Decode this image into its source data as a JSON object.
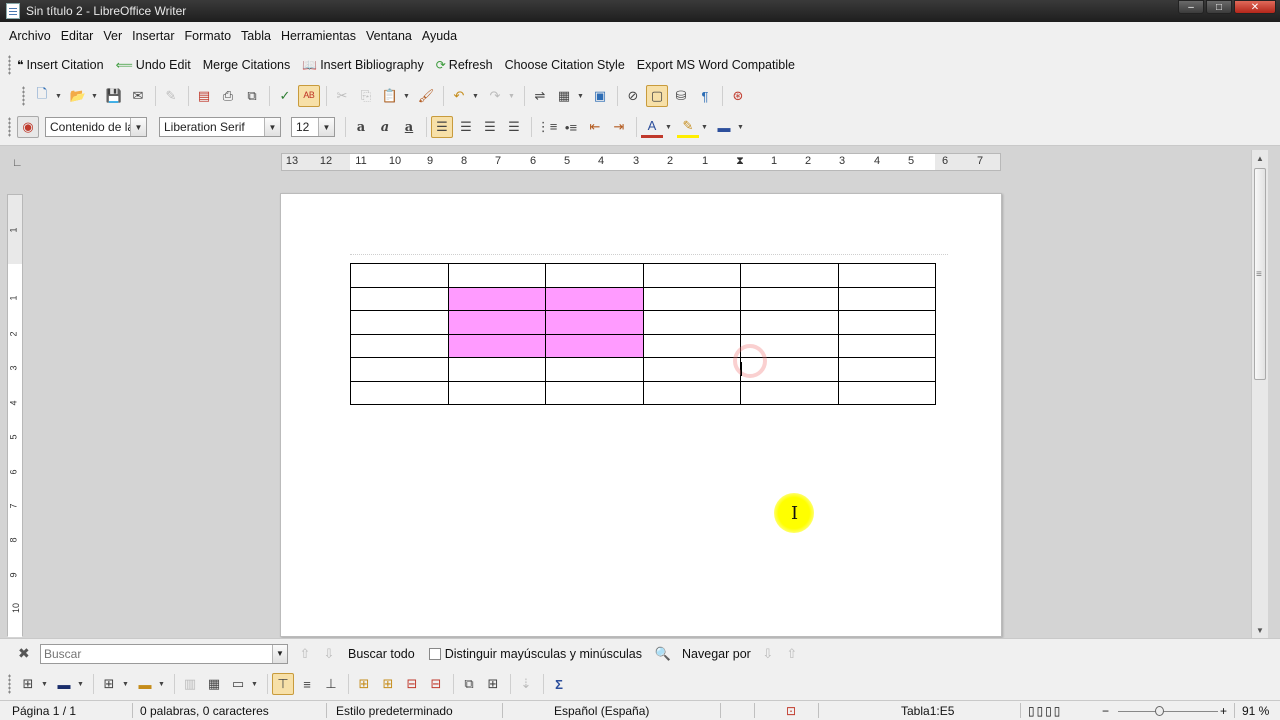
{
  "window": {
    "title": "Sin título 2 - LibreOffice Writer",
    "min": "–",
    "max": "□",
    "close": "✕"
  },
  "menu": [
    "Archivo",
    "Editar",
    "Ver",
    "Insertar",
    "Formato",
    "Tabla",
    "Herramientas",
    "Ventana",
    "Ayuda"
  ],
  "zotero": {
    "insert_citation": "Insert Citation",
    "undo_edit": "Undo Edit",
    "merge_citations": "Merge Citations",
    "insert_bibliography": "Insert Bibliography",
    "refresh": "Refresh",
    "choose_style": "Choose Citation Style",
    "export": "Export MS Word Compatible"
  },
  "formatting": {
    "paragraph_style": "Contenido de la",
    "font_name": "Liberation Serif",
    "font_size": "12"
  },
  "ruler": {
    "labels": [
      "13",
      "12",
      "11",
      "10",
      "9",
      "8",
      "7",
      "6",
      "5",
      "4",
      "3",
      "2",
      "1",
      "1",
      "2",
      "3",
      "4",
      "5",
      "6",
      "7"
    ],
    "vlabels": [
      "1",
      "1",
      "2",
      "3",
      "4",
      "5",
      "6",
      "7",
      "8",
      "9",
      "10"
    ]
  },
  "document": {
    "table": {
      "rows": 6,
      "cols": 6,
      "highlight_color": "#ff9bff"
    }
  },
  "find": {
    "placeholder": "Buscar",
    "find_all": "Buscar todo",
    "match_case": "Distinguir mayúsculas y minúsculas",
    "navigate": "Navegar por"
  },
  "status": {
    "page": "Página 1 / 1",
    "words": "0 palabras, 0 caracteres",
    "style": "Estilo predeterminado",
    "language": "Español (España)",
    "cell": "Tabla1:E5",
    "zoom": "91 %",
    "zoom_value": 0.91
  }
}
